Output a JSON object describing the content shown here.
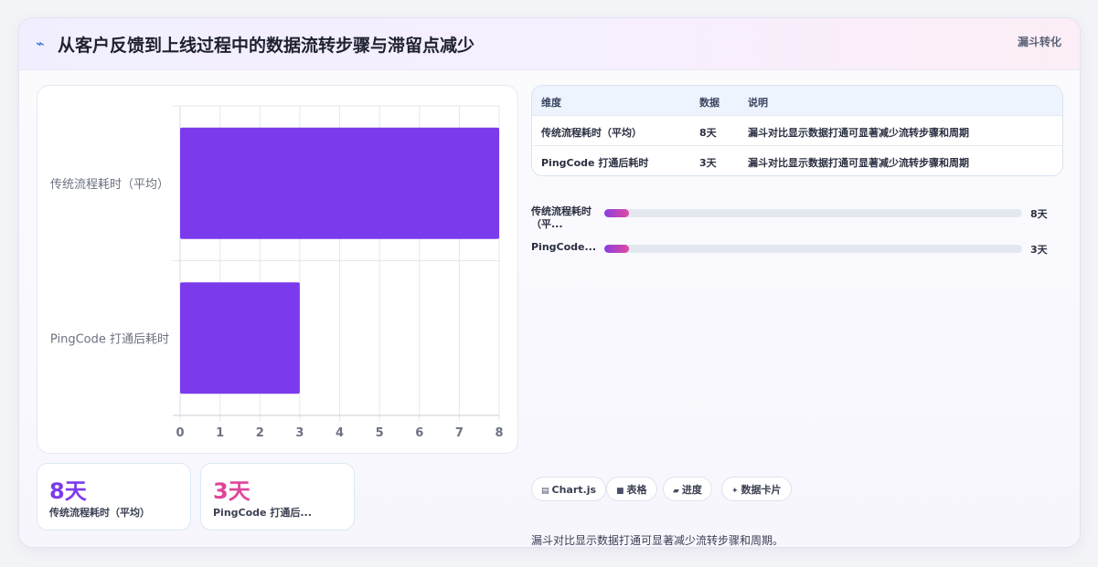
{
  "header": {
    "icon": "line-chart-icon",
    "title": "从客户反馈到上线过程中的数据流转步骤与滞留点减少",
    "tag": "漏斗转化"
  },
  "colors": {
    "bar": "#7c3aed",
    "accent_purple": "#7c3aed",
    "accent_pink": "#e0449a",
    "grid": "#e5e7eb"
  },
  "chart_data": {
    "type": "bar",
    "orientation": "horizontal",
    "categories": [
      "传统流程耗时（平均）",
      "PingCode 打通后耗时"
    ],
    "values": [
      8,
      3
    ],
    "xlim": [
      0,
      8
    ],
    "xticks": [
      "0",
      "1",
      "2",
      "3",
      "4",
      "5",
      "6",
      "7",
      "8"
    ],
    "grid": true,
    "legend": "none"
  },
  "stats": [
    {
      "value": "8天",
      "label": "传统流程耗时（平均）"
    },
    {
      "value": "3天",
      "label": "PingCode 打通后..."
    }
  ],
  "table": {
    "headers": [
      "维度",
      "数据",
      "说明"
    ],
    "rows": [
      [
        "传统流程耗时（平均）",
        "8天",
        "漏斗对比显示数据打通可显著减少流转步骤和周期"
      ],
      [
        "PingCode 打通后耗时",
        "3天",
        "漏斗对比显示数据打通可显著减少流转步骤和周期"
      ]
    ]
  },
  "progress": [
    {
      "label": "传统流程耗时（平...",
      "value": "8天",
      "fraction": 0.06
    },
    {
      "label": "PingCode...",
      "value": "3天",
      "fraction": 0.06
    }
  ],
  "pills": [
    {
      "icon": "chart-icon",
      "label": "Chart.js"
    },
    {
      "icon": "table-icon",
      "label": "表格"
    },
    {
      "icon": "progress-icon",
      "label": "进度"
    },
    {
      "icon": "sparkle-icon",
      "label": "数据卡片"
    }
  ],
  "note": "漏斗对比显示数据打通可显著减少流转步骤和周期。"
}
